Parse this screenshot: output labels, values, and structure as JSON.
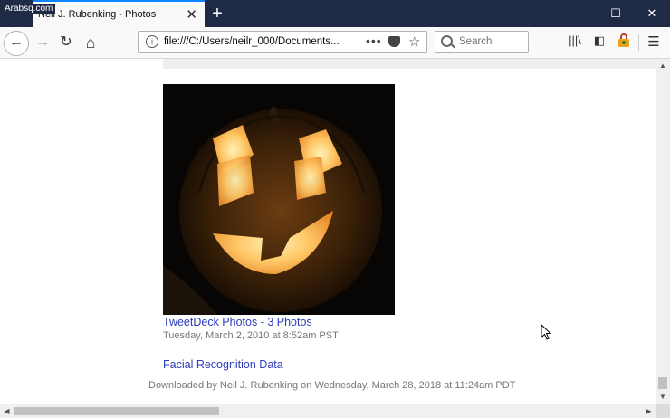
{
  "watermark": "Arabsq.com",
  "tab": {
    "title": "Neil J. Rubenking - Photos",
    "close": "✕"
  },
  "new_tab": "+",
  "window_controls": {
    "minimize": "—",
    "maximize": "☐",
    "close": "✕"
  },
  "toolbar": {
    "back": "←",
    "forward": "→",
    "reload": "↻",
    "home": "⌂",
    "url": "file:///C:/Users/neilr_000/Documents...",
    "page_actions": "•••",
    "bookmark_star": "☆",
    "search_placeholder": "Search",
    "library": "|||\\",
    "sidebar": "◧",
    "menu": "☰"
  },
  "content": {
    "album_link": "TweetDeck Photos - 3 Photos",
    "album_date": "Tuesday, March 2, 2010 at 8:52am PST",
    "facial_link": "Facial Recognition Data",
    "footer": "Downloaded by Neil J. Rubenking on Wednesday, March 28, 2018 at 11:24am PDT"
  },
  "scroll": {
    "up": "▲",
    "down": "▼",
    "left": "◀",
    "right": "▶"
  },
  "colors": {
    "titlebar": "#1f2a44",
    "link": "#2a3db8",
    "tab_accent": "#0a84ff"
  }
}
